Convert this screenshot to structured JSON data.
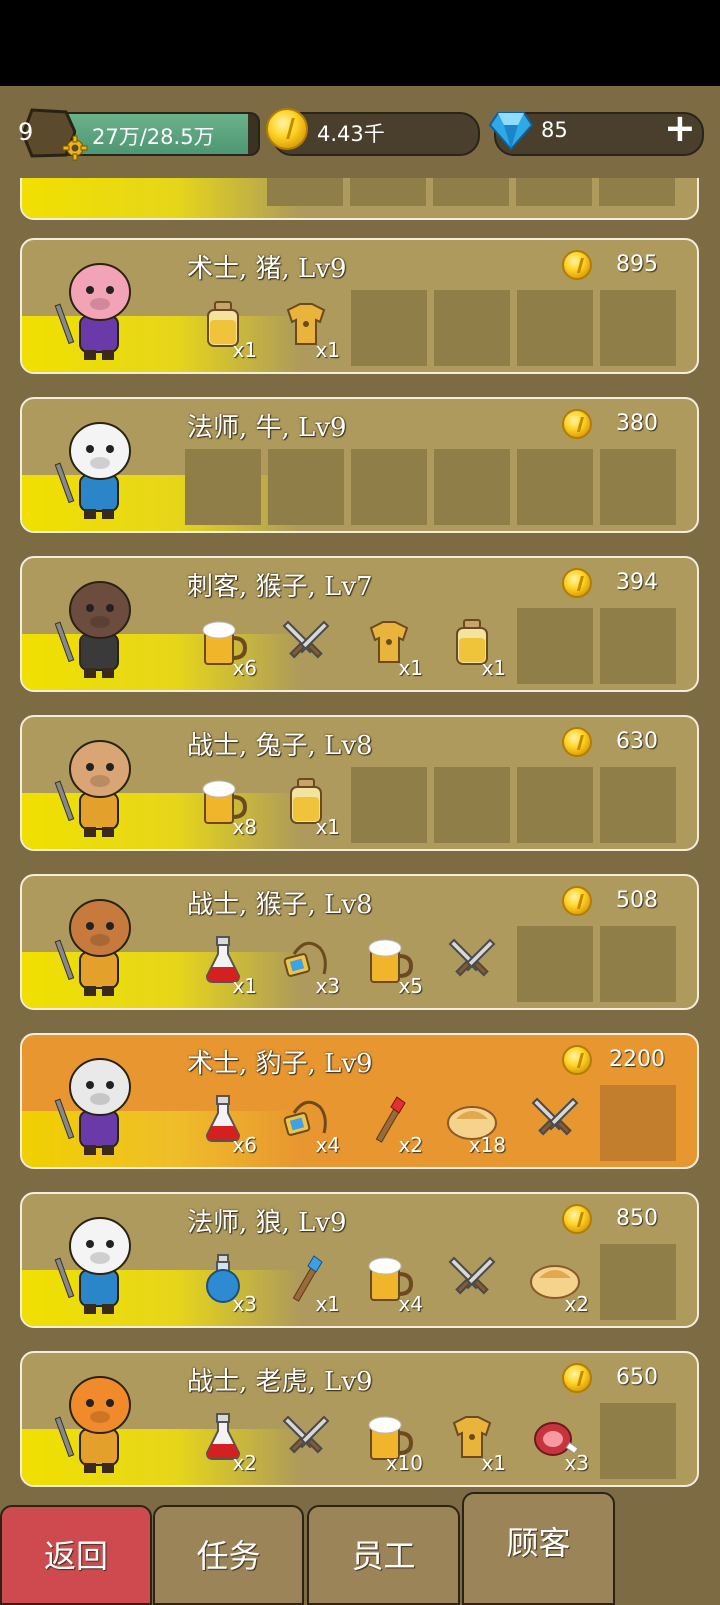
{
  "hud": {
    "level": "9",
    "xp_text": "27万/28.5万",
    "xp_fraction": 0.947,
    "gold": "4.43千",
    "gems": "85",
    "add_symbol": "+"
  },
  "customers": [
    {
      "name": "术士, 猪, Lv9",
      "reward": "895",
      "char": "pig",
      "cls": "mage-purple",
      "items": [
        {
          "icon": "potion-yellow",
          "qty": "x1"
        },
        {
          "icon": "leather-armor",
          "qty": "x1"
        }
      ]
    },
    {
      "name": "法师, 牛, Lv9",
      "reward": "380",
      "char": "cow",
      "cls": "mage-blue",
      "items": []
    },
    {
      "name": "刺客, 猴子, Lv7",
      "reward": "394",
      "char": "monkey-dark",
      "cls": "assassin",
      "items": [
        {
          "icon": "beer-mug",
          "qty": "x6"
        },
        {
          "icon": "crossed-swords",
          "qty": ""
        },
        {
          "icon": "leather-armor",
          "qty": "x1"
        },
        {
          "icon": "potion-yellow",
          "qty": "x1"
        }
      ]
    },
    {
      "name": "战士, 兔子, Lv8",
      "reward": "630",
      "char": "rabbit",
      "cls": "warrior",
      "items": [
        {
          "icon": "beer-mug",
          "qty": "x8"
        },
        {
          "icon": "potion-yellow",
          "qty": "x1"
        }
      ]
    },
    {
      "name": "战士, 猴子, Lv8",
      "reward": "508",
      "char": "monkey",
      "cls": "warrior",
      "items": [
        {
          "icon": "potion-red",
          "qty": "x1"
        },
        {
          "icon": "amulet",
          "qty": "x3"
        },
        {
          "icon": "beer-mug",
          "qty": "x5"
        },
        {
          "icon": "crossed-swords",
          "qty": ""
        }
      ]
    },
    {
      "name": "术士, 豹子, Lv9",
      "reward": "2200",
      "char": "leopard",
      "cls": "mage-purple",
      "highlight": true,
      "items": [
        {
          "icon": "potion-red",
          "qty": "x6"
        },
        {
          "icon": "amulet",
          "qty": "x4"
        },
        {
          "icon": "staff-red",
          "qty": "x2"
        },
        {
          "icon": "bread",
          "qty": "x18"
        },
        {
          "icon": "crossed-swords",
          "qty": ""
        }
      ]
    },
    {
      "name": "法师, 狼, Lv9",
      "reward": "850",
      "char": "wolf",
      "cls": "mage-blue",
      "items": [
        {
          "icon": "potion-blue",
          "qty": "x3"
        },
        {
          "icon": "staff-blue",
          "qty": "x1"
        },
        {
          "icon": "beer-mug",
          "qty": "x4"
        },
        {
          "icon": "crossed-swords",
          "qty": ""
        },
        {
          "icon": "bread",
          "qty": "x2"
        }
      ]
    },
    {
      "name": "战士, 老虎, Lv9",
      "reward": "650",
      "char": "tiger",
      "cls": "warrior",
      "items": [
        {
          "icon": "potion-red",
          "qty": "x2"
        },
        {
          "icon": "crossed-swords",
          "qty": ""
        },
        {
          "icon": "beer-mug",
          "qty": "x10"
        },
        {
          "icon": "leather-armor",
          "qty": "x1"
        },
        {
          "icon": "meat",
          "qty": "x3"
        }
      ]
    }
  ],
  "tabs": {
    "back": "返回",
    "quests": "任务",
    "staff": "员工",
    "customers": "顾客"
  }
}
